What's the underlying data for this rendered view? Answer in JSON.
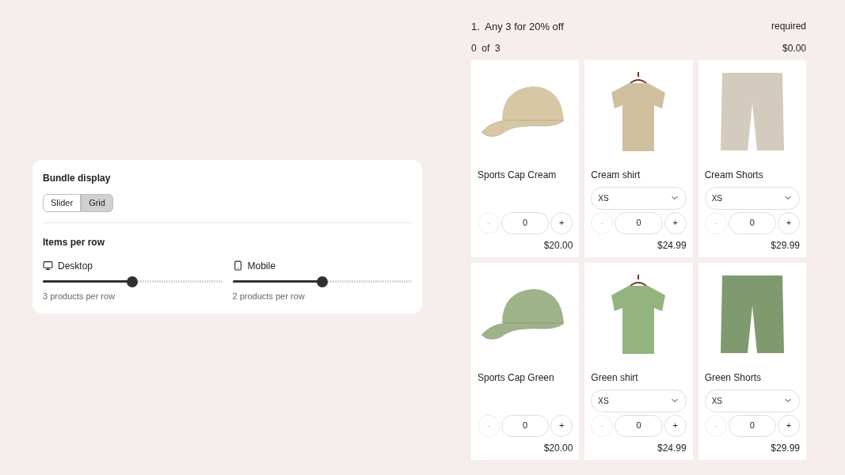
{
  "settings": {
    "title": "Bundle display",
    "display_options": [
      {
        "label": "Slider",
        "selected": false
      },
      {
        "label": "Grid",
        "selected": true
      }
    ],
    "items_title": "Items per row",
    "sliders": [
      {
        "kind": "desktop",
        "label": "Desktop",
        "level": 0.5,
        "reading": "3 products per row"
      },
      {
        "kind": "mobile",
        "label": "Mobile",
        "level": 0.5,
        "reading": "2 products per row"
      }
    ]
  },
  "bundle": {
    "title": "1.  Any 3 for 20% off",
    "requirement": "required",
    "count": "0  of  3",
    "total": "$0.00",
    "products": [
      {
        "name": "Sports Cap Cream",
        "kind": "cap",
        "color": "#d8c7a4",
        "minus": "-",
        "quantity": "0",
        "plus": "+",
        "minus_disabled": true,
        "price": "$20.00"
      },
      {
        "name": "Cream shirt",
        "kind": "shirt",
        "color": "#cfbf9f",
        "variant": "XS",
        "minus": "-",
        "quantity": "0",
        "plus": "+",
        "minus_disabled": true,
        "price": "$24.99"
      },
      {
        "name": "Cream Shorts",
        "kind": "shorts",
        "color": "#d3cbbd",
        "variant": "XS",
        "minus": "-",
        "quantity": "0",
        "plus": "+",
        "minus_disabled": true,
        "price": "$29.99"
      },
      {
        "name": "Sports Cap Green",
        "kind": "cap",
        "color": "#9fb38a",
        "minus": "-",
        "quantity": "0",
        "plus": "+",
        "minus_disabled": true,
        "price": "$20.00"
      },
      {
        "name": "Green shirt",
        "kind": "shirt",
        "color": "#94b47f",
        "variant": "XS",
        "minus": "-",
        "quantity": "0",
        "plus": "+",
        "minus_disabled": true,
        "price": "$24.99"
      },
      {
        "name": "Green Shorts",
        "kind": "shorts",
        "color": "#7f9a6e",
        "variant": "XS",
        "minus": "-",
        "quantity": "0",
        "plus": "+",
        "minus_disabled": true,
        "price": "$29.99"
      }
    ]
  }
}
